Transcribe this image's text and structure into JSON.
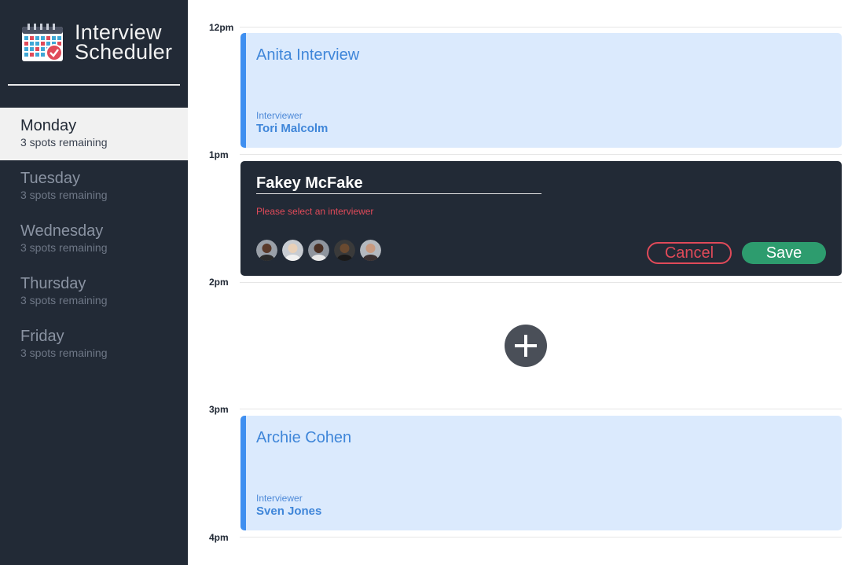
{
  "app": {
    "title_line1": "Interview",
    "title_line2": "Scheduler",
    "logo_icon": "calendar-check-icon"
  },
  "colors": {
    "sidebar_bg": "#222a36",
    "accent_blue": "#3f8ff0",
    "appointment_bg": "#dbeafd",
    "danger": "#e04a59",
    "success": "#2d9c6e"
  },
  "days": [
    {
      "name": "Monday",
      "spots": "3 spots remaining",
      "selected": true
    },
    {
      "name": "Tuesday",
      "spots": "3 spots remaining",
      "selected": false
    },
    {
      "name": "Wednesday",
      "spots": "3 spots remaining",
      "selected": false
    },
    {
      "name": "Thursday",
      "spots": "3 spots remaining",
      "selected": false
    },
    {
      "name": "Friday",
      "spots": "3 spots remaining",
      "selected": false
    }
  ],
  "schedule": {
    "hours": [
      "12pm",
      "1pm",
      "2pm",
      "3pm",
      "4pm"
    ],
    "appointments": [
      {
        "student": "Anita Interview",
        "interviewer_label": "Interviewer",
        "interviewer": "Tori Malcolm"
      },
      {
        "student": "Archie Cohen",
        "interviewer_label": "Interviewer",
        "interviewer": "Sven Jones"
      }
    ],
    "form": {
      "name_value": "Fakey McFake",
      "validation_message": "Please select an interviewer",
      "interviewer_avatars": [
        "avatar-1",
        "avatar-2",
        "avatar-3",
        "avatar-4",
        "avatar-5"
      ],
      "cancel_label": "Cancel",
      "save_label": "Save"
    },
    "add_icon": "plus-icon"
  }
}
